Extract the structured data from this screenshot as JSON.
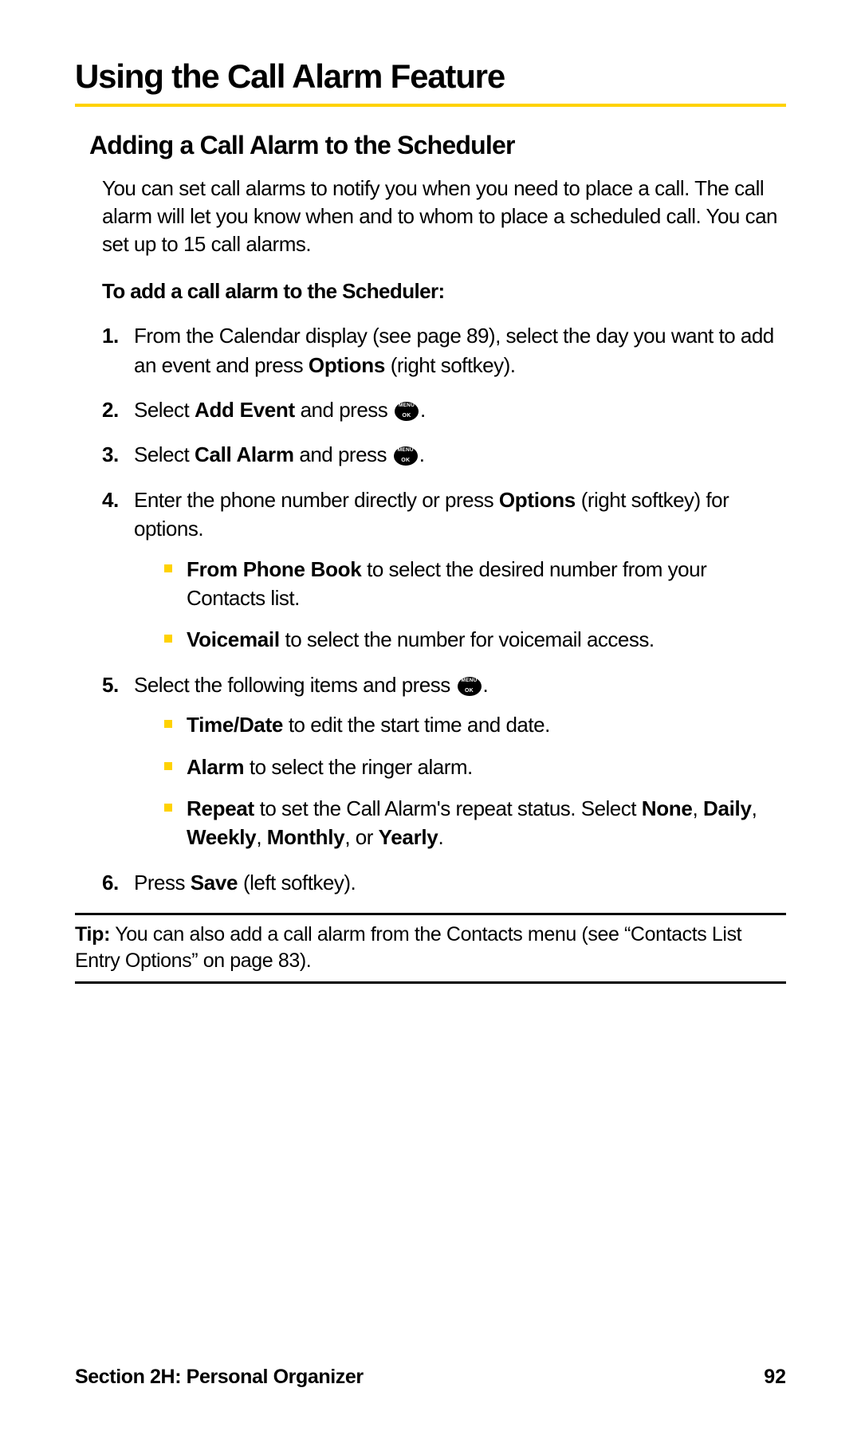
{
  "title": "Using the Call Alarm Feature",
  "section_heading": "Adding a Call Alarm to the Scheduler",
  "intro": "You can set call alarms to notify you when you need to place a call. The call alarm will let you know when and to whom to place a scheduled call. You can set up to 15 call alarms.",
  "subhead": "To add a call alarm to the Scheduler:",
  "steps": {
    "s1_num": "1.",
    "s1_a": "From the Calendar display (see page 89), select the day you want to add an event and press ",
    "s1_b": "Options",
    "s1_c": " (right softkey).",
    "s2_num": "2.",
    "s2_a": "Select ",
    "s2_b": "Add Event",
    "s2_c": " and press ",
    "s2_d": ".",
    "s3_num": "3.",
    "s3_a": "Select ",
    "s3_b": "Call Alarm",
    "s3_c": " and press ",
    "s3_d": ".",
    "s4_num": "4.",
    "s4_a": "Enter the phone number directly or press ",
    "s4_b": "Options",
    "s4_c": " (right softkey) for options.",
    "s4_sub1_a": "From Phone Book",
    "s4_sub1_b": " to select the desired number from your Contacts list.",
    "s4_sub2_a": "Voicemail",
    "s4_sub2_b": " to select the number for voicemail access.",
    "s5_num": "5.",
    "s5_a": "Select the following items and press ",
    "s5_b": ".",
    "s5_sub1_a": "Time/Date",
    "s5_sub1_b": " to edit the start time and date.",
    "s5_sub2_a": "Alarm",
    "s5_sub2_b": " to select the ringer alarm.",
    "s5_sub3_a": "Repeat",
    "s5_sub3_b": " to set the Call Alarm's repeat status. Select ",
    "s5_sub3_c": "None",
    "s5_sub3_d": ", ",
    "s5_sub3_e": "Daily",
    "s5_sub3_f": ", ",
    "s5_sub3_g": "Weekly",
    "s5_sub3_h": ", ",
    "s5_sub3_i": "Monthly",
    "s5_sub3_j": ", or ",
    "s5_sub3_k": "Yearly",
    "s5_sub3_l": ".",
    "s6_num": "6.",
    "s6_a": "Press ",
    "s6_b": "Save",
    "s6_c": " (left softkey)."
  },
  "tip_label": "Tip:",
  "tip_text": " You can also add a call alarm from the Contacts menu (see “Contacts List Entry Options” on page 83).",
  "footer_left": "Section 2H: Personal Organizer",
  "footer_right": "92"
}
